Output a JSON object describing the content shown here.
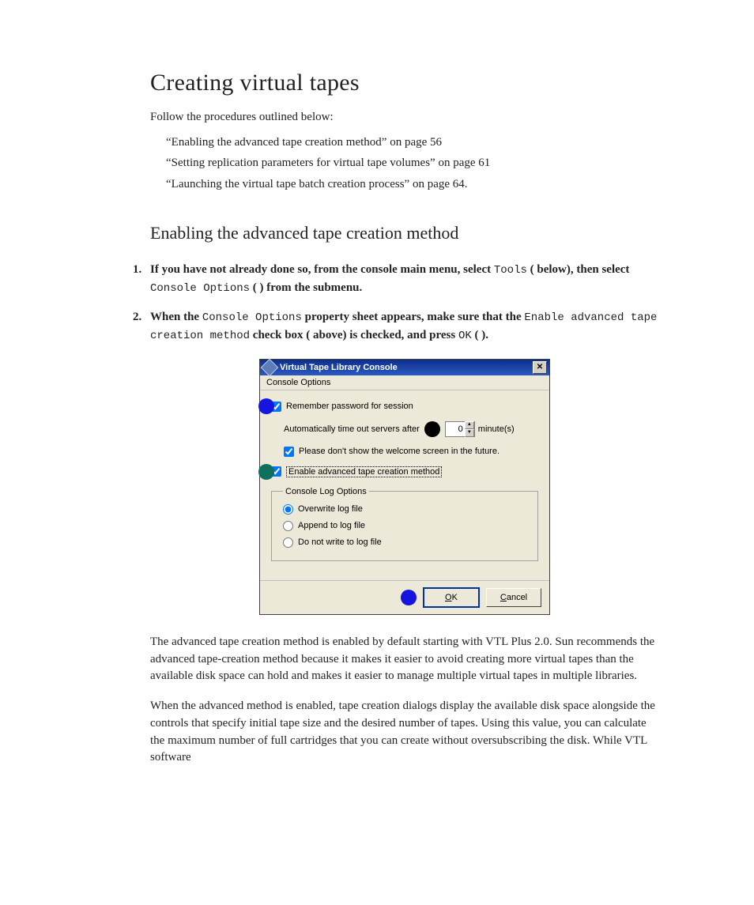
{
  "title": "Creating virtual tapes",
  "intro": "Follow the procedures outlined below:",
  "refs": [
    "“Enabling the advanced tape creation method” on page 56",
    "“Setting replication parameters for virtual tape volumes” on page 61",
    "“Launching the virtual tape batch creation process” on page 64."
  ],
  "section_title": "Enabling the advanced tape creation method",
  "steps": {
    "s1": {
      "pre": "If you have not already done so, from the console main menu, select ",
      "tools": "Tools",
      "mid": " (   below), then select ",
      "console_options": "Console Options",
      "post": " (  ) from the submenu."
    },
    "s2": {
      "pre": "When the ",
      "console_options": "Console Options",
      "mid1": " property sheet appears, make sure that the ",
      "enable_opt": "Enable advanced tape creation method",
      "mid2": " check box (   above) is checked, and press ",
      "ok": "OK",
      "post": " (  )."
    }
  },
  "dialog": {
    "title": "Virtual Tape Library Console",
    "menu": "Console Options",
    "checkbox_remember": "Remember password for session",
    "timeout_label_pre": "Automatically time out servers after",
    "timeout_value": "0",
    "timeout_label_post": "minute(s)",
    "checkbox_no_welcome": "Please don't show the welcome screen in the future.",
    "checkbox_adv_tape": "Enable advanced tape creation method",
    "log_legend": "Console Log Options",
    "radio_overwrite": "Overwrite log file",
    "radio_append": "Append to log file",
    "radio_nowrite": "Do not write to log file",
    "btn_ok_u": "O",
    "btn_ok_rest": "K",
    "btn_cancel_u": "C",
    "btn_cancel_rest": "ancel",
    "close_glyph": "✕"
  },
  "para1": "The advanced tape creation method is enabled by default starting with VTL Plus 2.0. Sun recommends the advanced tape-creation method because it makes it easier to avoid creating more virtual tapes than the available disk space can hold and makes it easier to manage multiple virtual tapes in multiple libraries.",
  "para2": "When the advanced method is enabled, tape creation dialogs display the available disk space alongside the controls that specify initial tape size and the desired number of tapes. Using this value, you can calculate the maximum number of full cartridges that you can create without oversubscribing the disk. While VTL software"
}
